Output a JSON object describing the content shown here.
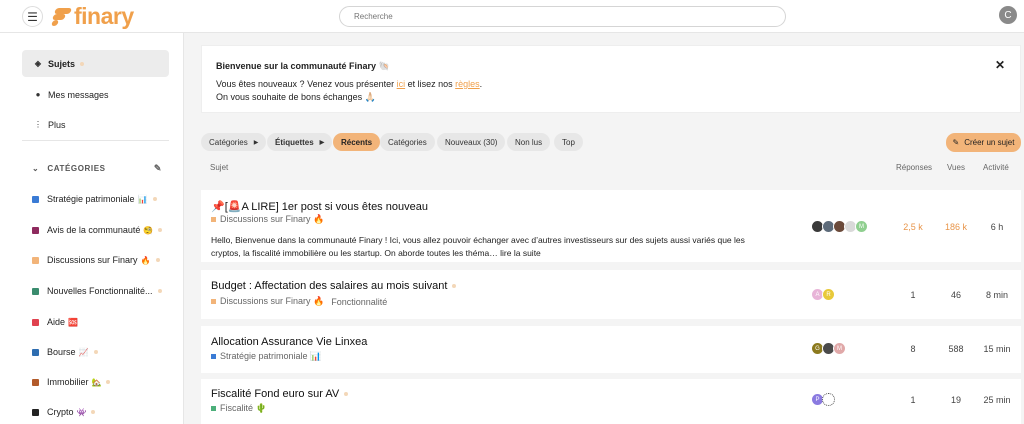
{
  "header": {
    "menu_icon": "hamburger-icon",
    "logo_text": "finary",
    "search_placeholder": "Recherche",
    "user_initial": "C"
  },
  "sidebar": {
    "nav": [
      {
        "label": "Sujets",
        "icon": "layers-icon"
      },
      {
        "label": "Mes messages",
        "icon": "user-icon"
      },
      {
        "label": "Plus",
        "icon": "more-vertical-icon"
      }
    ],
    "categories_header": "CATÉGORIES",
    "categories": [
      {
        "label": "Stratégie patrimoniale",
        "emoji": "📊",
        "color": "#3a7bd5"
      },
      {
        "label": "Avis de la communauté",
        "emoji": "🧐",
        "color": "#8e2a5e"
      },
      {
        "label": "Discussions sur Finary",
        "emoji": "🔥",
        "color": "#f2b479"
      },
      {
        "label": "Nouvelles Fonctionnalité...",
        "emoji": "",
        "color": "#3a8c6e"
      },
      {
        "label": "Aide",
        "emoji": "🆘",
        "color": "#e0424f"
      },
      {
        "label": "Bourse",
        "emoji": "📈",
        "color": "#2e6db0"
      },
      {
        "label": "Immobilier",
        "emoji": "🏡",
        "color": "#b25a2a"
      },
      {
        "label": "Crypto",
        "emoji": "👾",
        "color": "#222222"
      }
    ]
  },
  "banner": {
    "title": "Bienvenue sur la communauté Finary 🐚",
    "line1_a": "Vous êtes nouveaux ? Venez vous présenter ",
    "line1_link1": "ici",
    "line1_b": " et lisez nos ",
    "line1_link2": "règles",
    "line1_c": ".",
    "line2": "On vous souhaite de bons échanges 🙏🏻"
  },
  "filters": {
    "categories": "Catégories",
    "tags": "Étiquettes",
    "tabs": [
      "Récents",
      "Catégories",
      "Nouveaux (30)",
      "Non lus",
      "Top"
    ],
    "active_tab": "Récents",
    "create": "Créer un sujet"
  },
  "columns": {
    "topic": "Sujet",
    "replies": "Réponses",
    "views": "Vues",
    "activity": "Activité"
  },
  "topics": [
    {
      "title": "📌[🚨A LIRE] 1er post si vous êtes nouveau",
      "category": "Discussions sur Finary 🔥",
      "category_color": "#f2b479",
      "tag": "",
      "excerpt": "Hello, Bienvenue dans la communauté Finary ! Ici, vous allez pouvoir échanger avec d’autres investisseurs sur des sujets aussi variés que les cryptos, la fiscalité immobilière ou les startup. On aborde toutes les théma…",
      "read_more": "lire la suite",
      "avatars": [
        "",
        "",
        "",
        "",
        "M"
      ],
      "replies": "2,5 k",
      "views": "186 k",
      "activity": "6 h"
    },
    {
      "title": "Budget : Affectation des salaires au mois suivant",
      "category": "Discussions sur Finary 🔥",
      "category_color": "#f2b479",
      "tag": "Fonctionnalité",
      "avatars": [
        "A",
        "R"
      ],
      "replies": "1",
      "views": "46",
      "activity": "8 min"
    },
    {
      "title": "Allocation Assurance Vie Linxea",
      "category": "Stratégie patrimoniale 📊",
      "category_color": "#3a7bd5",
      "tag": "",
      "avatars": [
        "G",
        "",
        "M"
      ],
      "replies": "8",
      "views": "588",
      "activity": "15 min"
    },
    {
      "title": "Fiscalité Fond euro sur AV",
      "category": "Fiscalité 🌵",
      "category_color": "#4caf7a",
      "tag": "",
      "avatars": [
        "P",
        ""
      ],
      "replies": "1",
      "views": "19",
      "activity": "25 min"
    }
  ]
}
